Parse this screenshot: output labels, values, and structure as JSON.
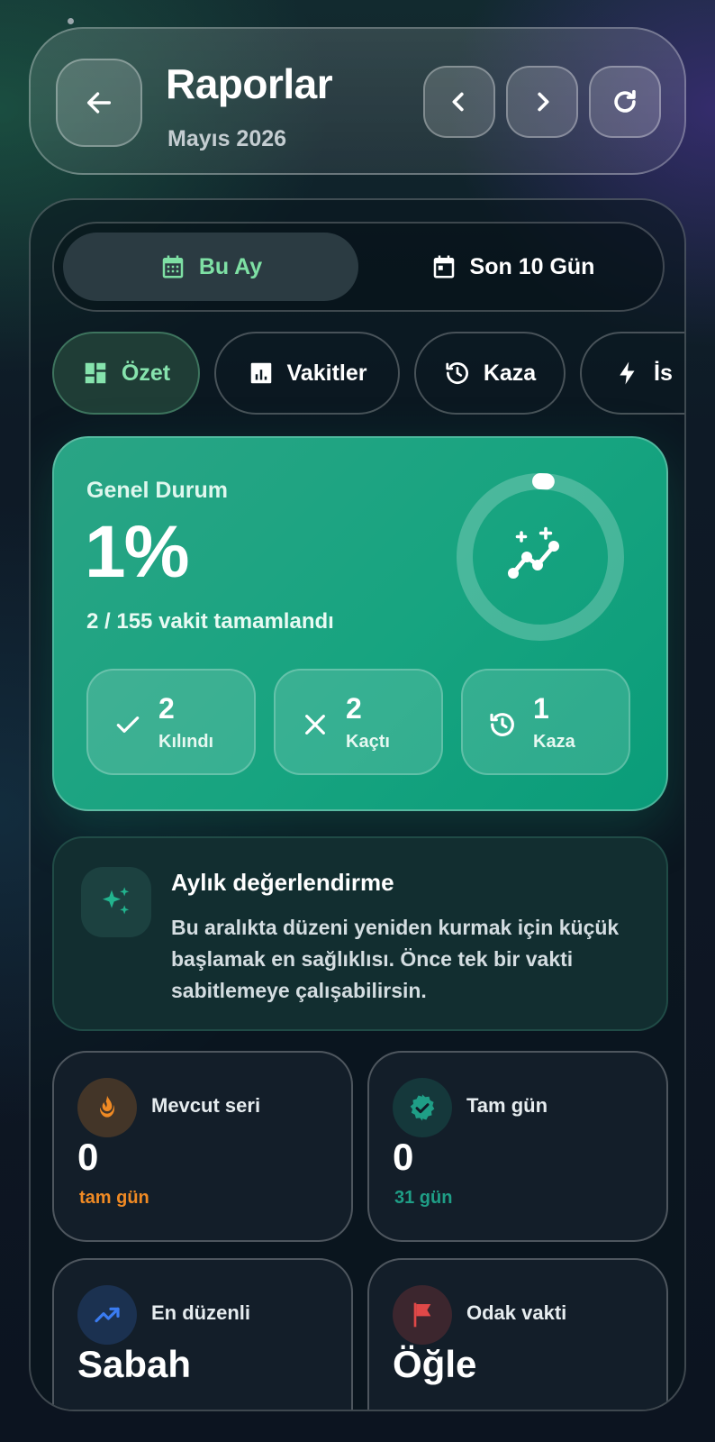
{
  "header": {
    "title": "Raporlar",
    "subtitle": "Mayıs 2026"
  },
  "range_toggle": {
    "active": "Bu Ay",
    "inactive": "Son 10 Gün"
  },
  "chips": [
    {
      "label": "Özet",
      "icon": "dashboard-icon",
      "active": true
    },
    {
      "label": "Vakitler",
      "icon": "bar-chart-icon",
      "active": false
    },
    {
      "label": "Kaza",
      "icon": "history-icon",
      "active": false
    },
    {
      "label": "İs",
      "icon": "bolt-icon",
      "active": false
    }
  ],
  "summary": {
    "label": "Genel Durum",
    "percent": "1%",
    "progress_fraction": 0.013,
    "detail": "2 / 155 vakit tamamlandı",
    "stats": [
      {
        "value": "2",
        "label": "Kılındı",
        "icon": "check-icon"
      },
      {
        "value": "2",
        "label": "Kaçtı",
        "icon": "x-icon"
      },
      {
        "value": "1",
        "label": "Kaza",
        "icon": "history-icon"
      }
    ]
  },
  "insight": {
    "title": "Aylık değerlendirme",
    "body": "Bu aralıkta düzeni yeniden kurmak için küçük başlamak en sağlıklısı. Önce tek bir vakti sabitlemeye çalışabilirsin."
  },
  "metrics": [
    {
      "label": "Mevcut seri",
      "value": "0",
      "sub": "tam gün",
      "icon": "flame-icon",
      "accent": "#f08a24"
    },
    {
      "label": "Tam gün",
      "value": "0",
      "sub": "31 gün",
      "icon": "verified-badge-icon",
      "accent": "#1f9e86"
    },
    {
      "label": "En düzenli",
      "value": "Sabah",
      "sub": "",
      "icon": "trending-up-icon",
      "accent": "#3a7bf0"
    },
    {
      "label": "Odak vakti",
      "value": "Öğle",
      "sub": "",
      "icon": "flag-icon",
      "accent": "#e04848"
    }
  ],
  "colors": {
    "accent_green": "#7ee0a4",
    "hero_teal": "#17a480"
  }
}
